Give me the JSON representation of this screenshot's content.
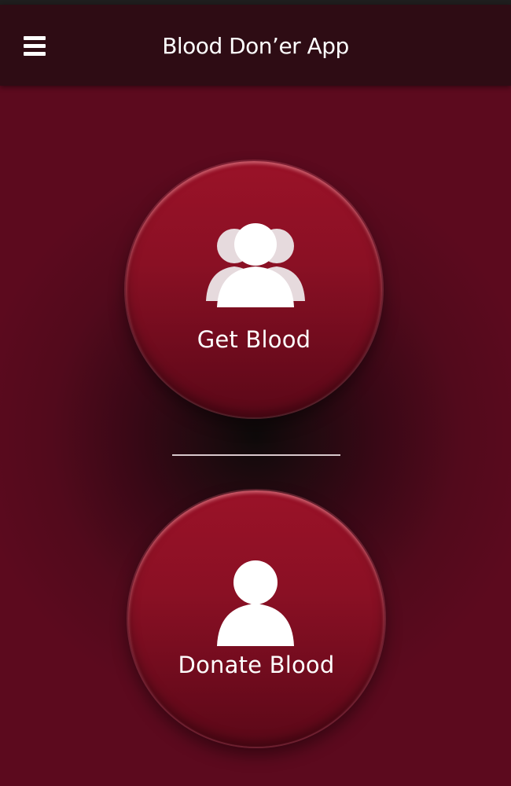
{
  "header": {
    "title": "Blood Don’er App",
    "menu_icon": "hamburger-menu-icon"
  },
  "actions": {
    "get_blood": {
      "label": "Get Blood",
      "icon": "people-group-icon"
    },
    "donate_blood": {
      "label": "Donate Blood",
      "icon": "person-icon"
    }
  },
  "colors": {
    "header_bg": "#2e0c14",
    "page_bg": "#5c0a1e",
    "button_red": "#8a1024",
    "text": "#ffffff"
  }
}
